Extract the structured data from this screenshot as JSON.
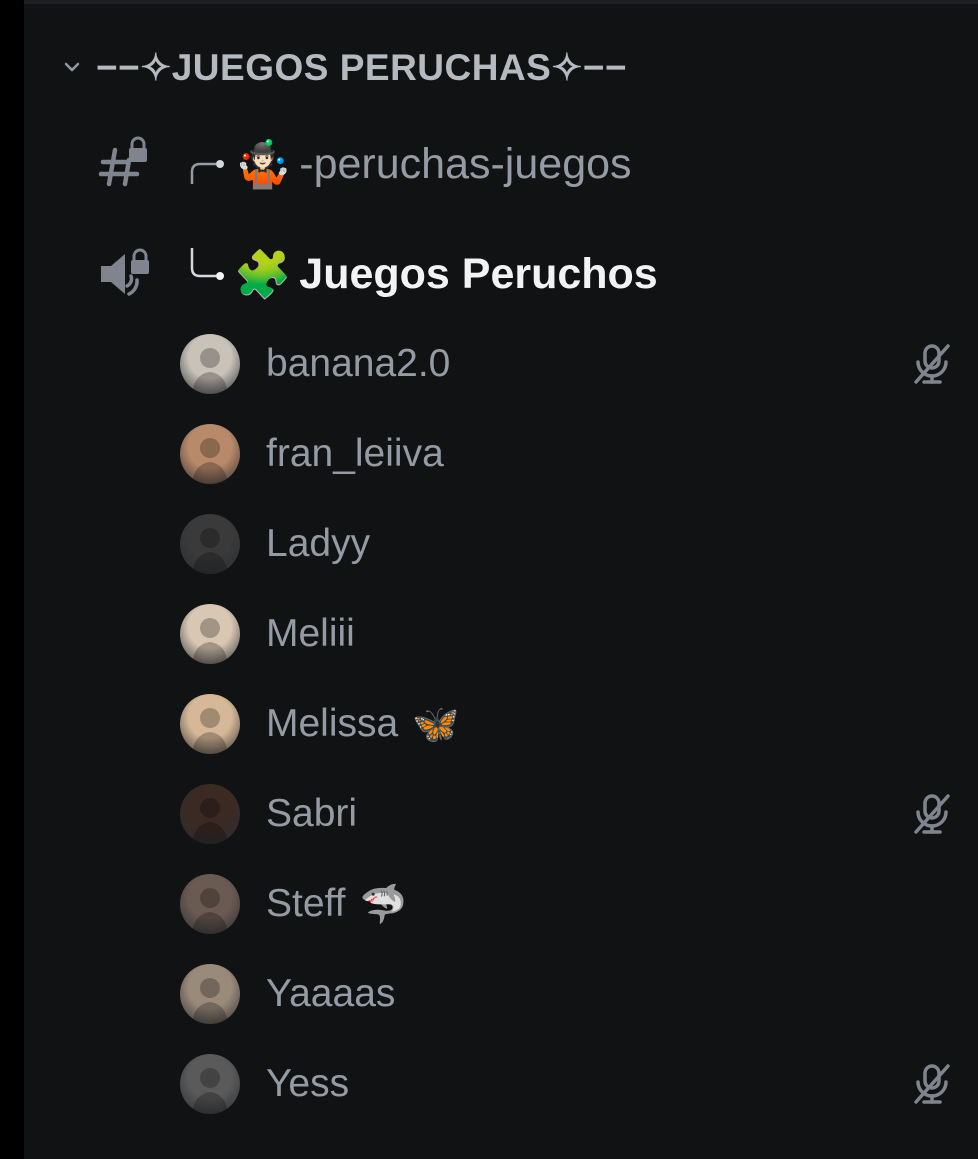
{
  "category": {
    "label": "−−✧JUEGOS PERUCHAS✧−−",
    "chevron_icon": "chevron-down-icon"
  },
  "channels": [
    {
      "type": "text",
      "icon": "locked-hash-icon",
      "emoji": "🤹🏻",
      "label": "-peruchas-juegos"
    },
    {
      "type": "voice",
      "icon": "locked-speaker-icon",
      "emoji": "🧩",
      "label": "Juegos Peruchos"
    }
  ],
  "voice_users": [
    {
      "name": "banana2.0",
      "emoji": "",
      "muted": true,
      "avatar_color": "#c8c2b8"
    },
    {
      "name": "fran_leiiva",
      "emoji": "",
      "muted": false,
      "avatar_color": "#b98a6a"
    },
    {
      "name": "Ladyy",
      "emoji": "",
      "muted": false,
      "avatar_color": "#3a3a3a"
    },
    {
      "name": "Meliii",
      "emoji": "",
      "muted": false,
      "avatar_color": "#d9c7b3"
    },
    {
      "name": "Melissa",
      "emoji": "🦋",
      "muted": false,
      "avatar_color": "#d6b898"
    },
    {
      "name": "Sabri",
      "emoji": "",
      "muted": true,
      "avatar_color": "#3b2a24"
    },
    {
      "name": "Steff",
      "emoji": "🦈",
      "muted": false,
      "avatar_color": "#6b5a52"
    },
    {
      "name": "Yaaaas",
      "emoji": "",
      "muted": false,
      "avatar_color": "#9a8a7a"
    },
    {
      "name": "Yess",
      "emoji": "",
      "muted": true,
      "avatar_color": "#5a5a5a"
    }
  ],
  "colors": {
    "background": "#111214",
    "muted_text": "#949ba4",
    "active_text": "#f2f3f5",
    "icon": "#80848e"
  }
}
